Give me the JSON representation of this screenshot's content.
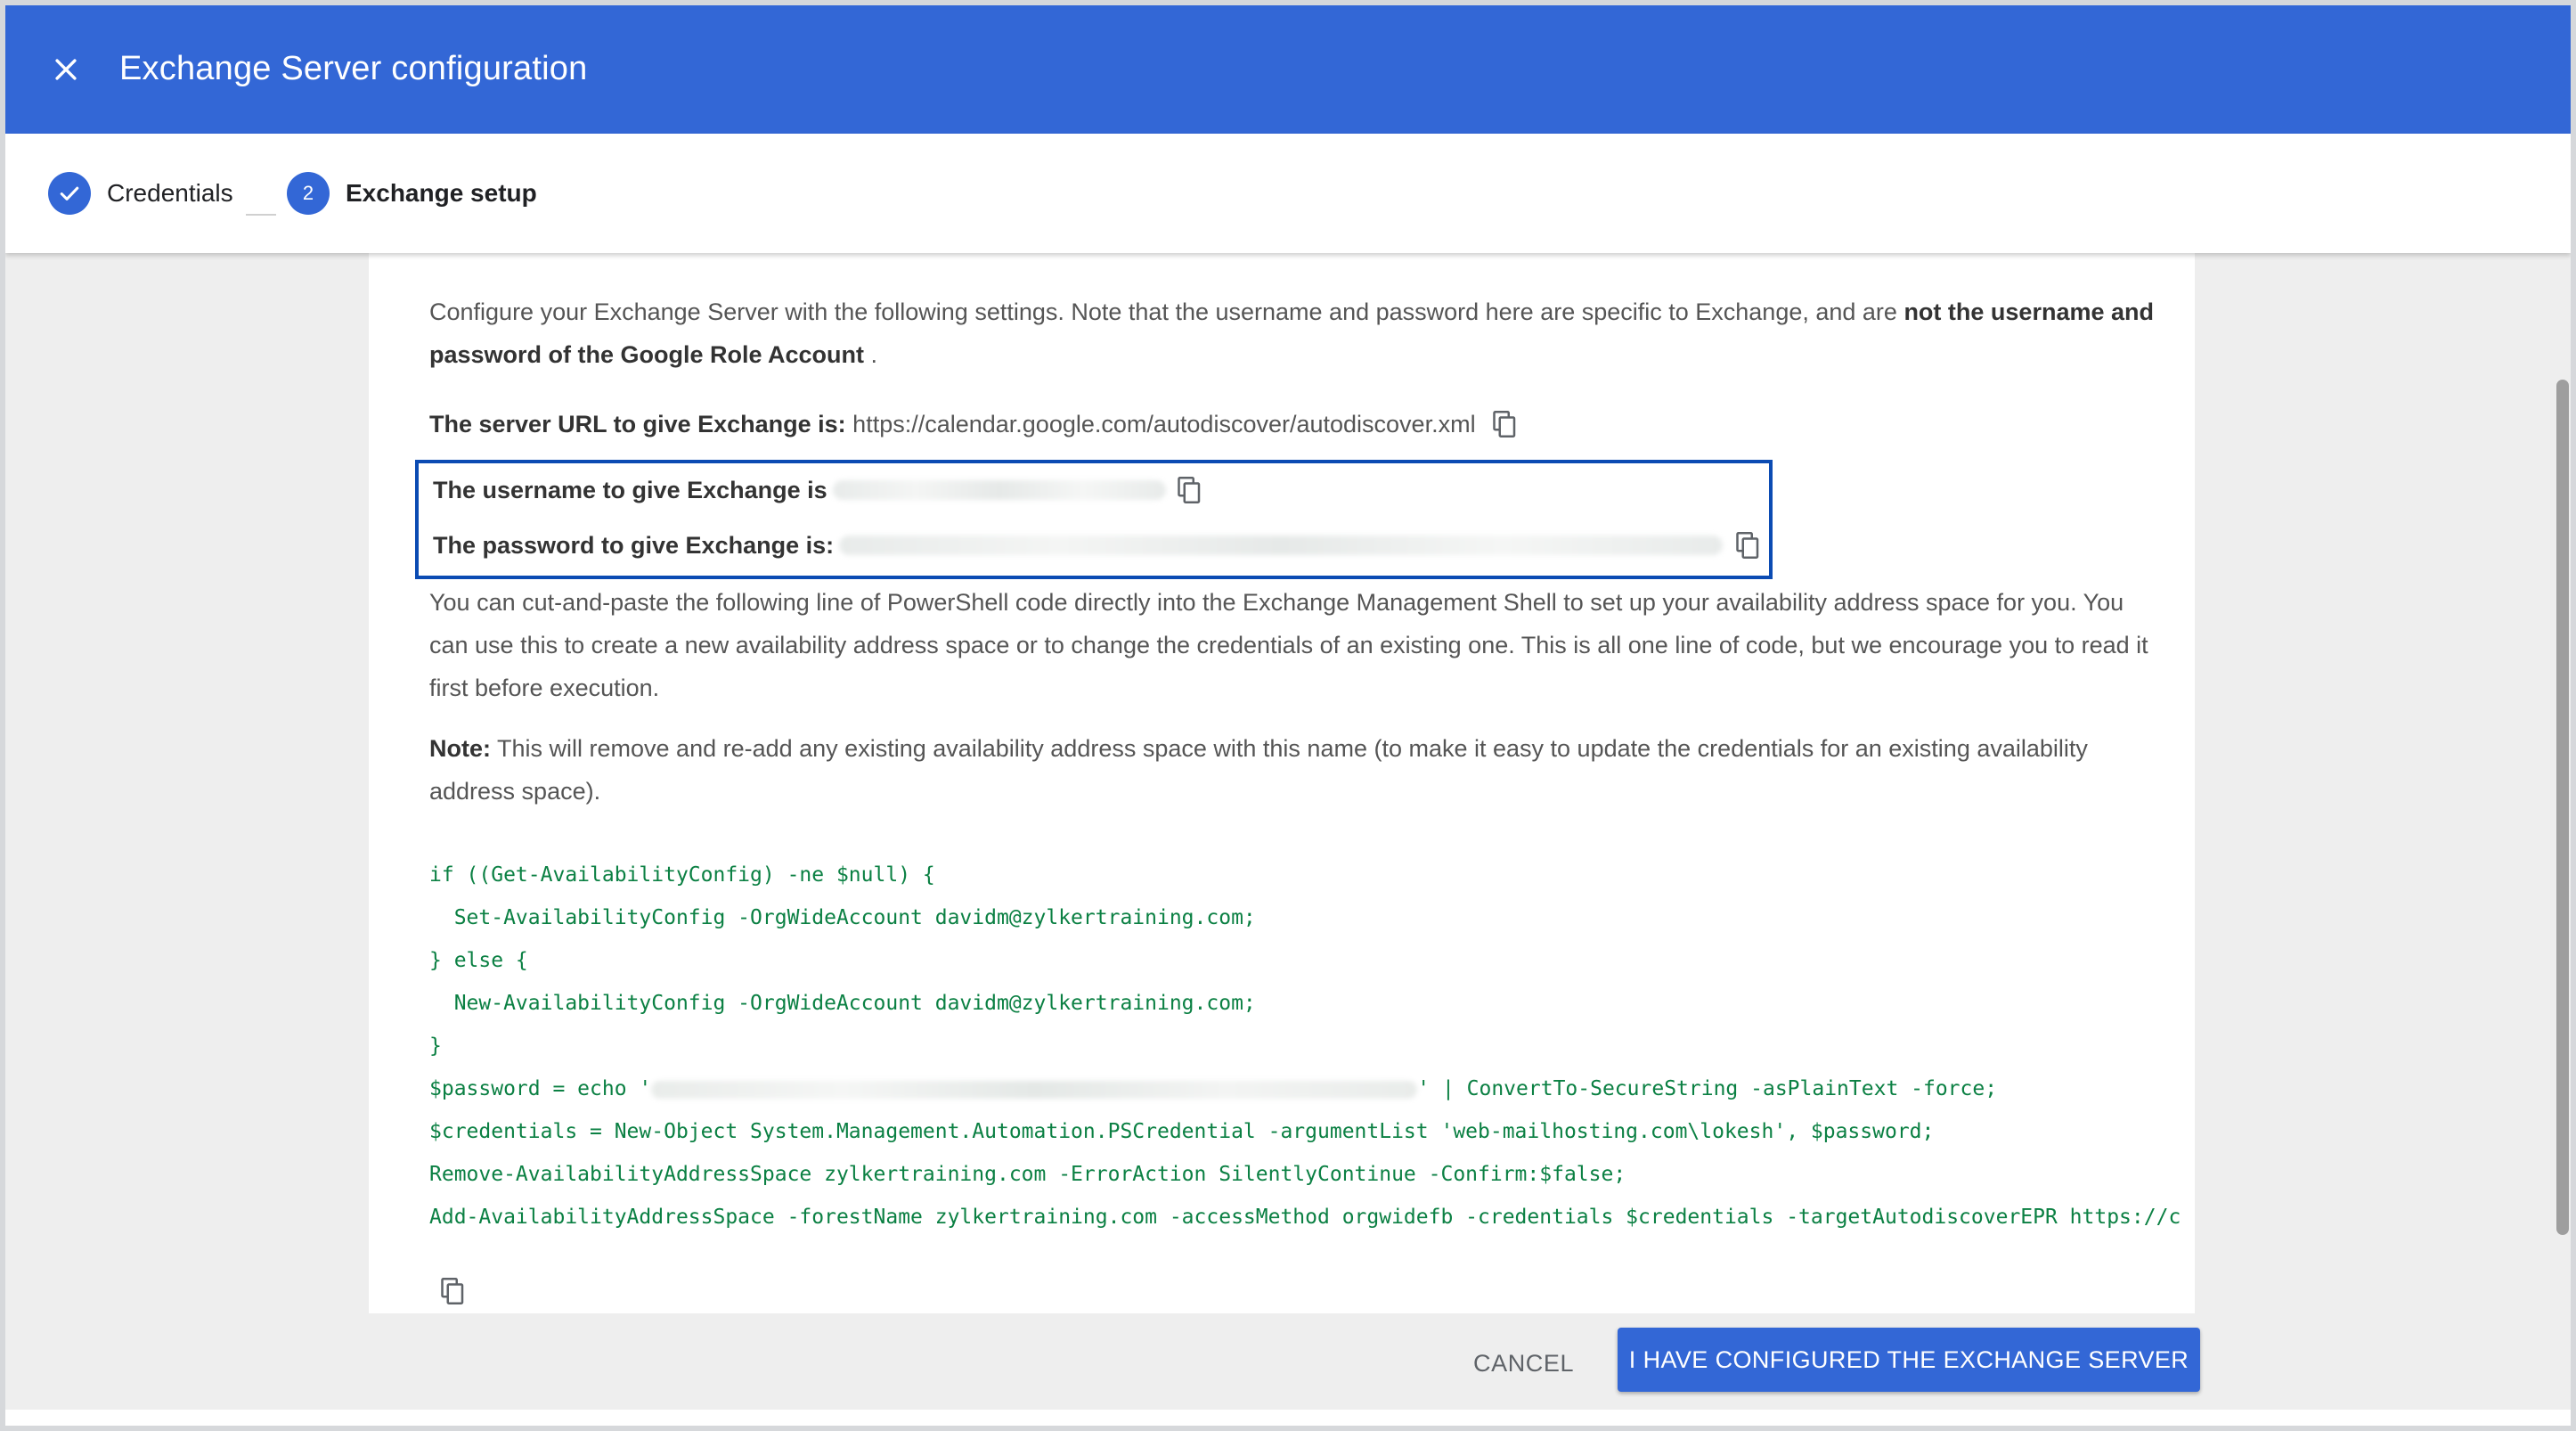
{
  "header": {
    "title": "Exchange Server configuration",
    "close_icon": "close-icon",
    "color": "#3367d6"
  },
  "stepper": {
    "steps": [
      {
        "label": "Credentials",
        "state": "completed",
        "icon": "check-icon"
      },
      {
        "number": "2",
        "label": "Exchange setup",
        "state": "active"
      }
    ]
  },
  "content": {
    "intro_text": "Configure your Exchange Server with the following settings. Note that the username and password here are specific to Exchange, and are ",
    "intro_bold": "not the username and password of the Google Role Account",
    "intro_end": " .",
    "server_url_label": "The server URL to give Exchange is:",
    "server_url_value": " https://calendar.google.com/autodiscover/autodiscover.xml",
    "username_label": "The username to give Exchange is",
    "password_label": "The password to give Exchange is:",
    "powershell_text": "You can cut-and-paste the following line of PowerShell code directly into the Exchange Management Shell to set up your availability address space for you. You can use this to create a new availability address space or to change the credentials of an existing one. This is all one line of code, but we encourage you to read it first before execution.",
    "note_label": "Note:",
    "note_text": " This will remove and re-add any existing availability address space with this name (to make it easy to update the credentials for an existing availability address space).",
    "code_lines": {
      "l1": "if ((Get-AvailabilityConfig) -ne $null) {",
      "l2": "  Set-AvailabilityConfig -OrgWideAccount davidm@zylkertraining.com;",
      "l3": "} else {",
      "l4": "  New-AvailabilityConfig -OrgWideAccount davidm@zylkertraining.com;",
      "l5": "}",
      "l6_start": "$password = echo '",
      "l6_end": "' | ConvertTo-SecureString -asPlainText -force;",
      "l7": "$credentials = New-Object System.Management.Automation.PSCredential -argumentList 'web-mailhosting.com\\lokesh', $password;",
      "l8": "Remove-AvailabilityAddressSpace zylkertraining.com -ErrorAction SilentlyContinue -Confirm:$false;",
      "l9": "Add-AvailabilityAddressSpace -forestName zylkertraining.com -accessMethod orgwidefb -credentials $credentials -targetAutodiscoverEPR https://c"
    },
    "copy_icon": "copy-icon",
    "code_color": "#0b8043"
  },
  "footer": {
    "cancel_label": "CANCEL",
    "confirm_label": "I HAVE CONFIGURED THE EXCHANGE SERVER"
  }
}
